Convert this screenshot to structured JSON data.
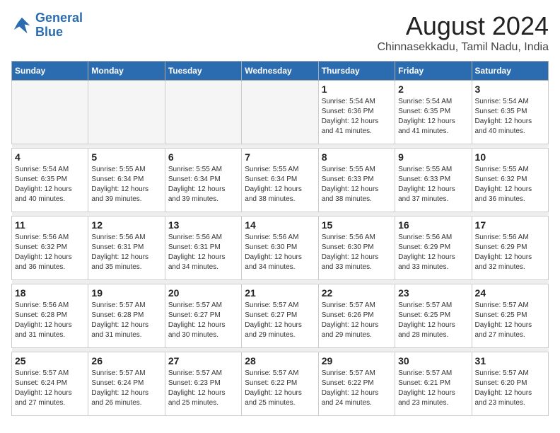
{
  "logo": {
    "line1": "General",
    "line2": "Blue"
  },
  "title": "August 2024",
  "subtitle": "Chinnasekkadu, Tamil Nadu, India",
  "days_of_week": [
    "Sunday",
    "Monday",
    "Tuesday",
    "Wednesday",
    "Thursday",
    "Friday",
    "Saturday"
  ],
  "weeks": [
    [
      {
        "date": "",
        "info": ""
      },
      {
        "date": "",
        "info": ""
      },
      {
        "date": "",
        "info": ""
      },
      {
        "date": "",
        "info": ""
      },
      {
        "date": "1",
        "info": "Sunrise: 5:54 AM\nSunset: 6:36 PM\nDaylight: 12 hours\nand 41 minutes."
      },
      {
        "date": "2",
        "info": "Sunrise: 5:54 AM\nSunset: 6:35 PM\nDaylight: 12 hours\nand 41 minutes."
      },
      {
        "date": "3",
        "info": "Sunrise: 5:54 AM\nSunset: 6:35 PM\nDaylight: 12 hours\nand 40 minutes."
      }
    ],
    [
      {
        "date": "4",
        "info": "Sunrise: 5:54 AM\nSunset: 6:35 PM\nDaylight: 12 hours\nand 40 minutes."
      },
      {
        "date": "5",
        "info": "Sunrise: 5:55 AM\nSunset: 6:34 PM\nDaylight: 12 hours\nand 39 minutes."
      },
      {
        "date": "6",
        "info": "Sunrise: 5:55 AM\nSunset: 6:34 PM\nDaylight: 12 hours\nand 39 minutes."
      },
      {
        "date": "7",
        "info": "Sunrise: 5:55 AM\nSunset: 6:34 PM\nDaylight: 12 hours\nand 38 minutes."
      },
      {
        "date": "8",
        "info": "Sunrise: 5:55 AM\nSunset: 6:33 PM\nDaylight: 12 hours\nand 38 minutes."
      },
      {
        "date": "9",
        "info": "Sunrise: 5:55 AM\nSunset: 6:33 PM\nDaylight: 12 hours\nand 37 minutes."
      },
      {
        "date": "10",
        "info": "Sunrise: 5:55 AM\nSunset: 6:32 PM\nDaylight: 12 hours\nand 36 minutes."
      }
    ],
    [
      {
        "date": "11",
        "info": "Sunrise: 5:56 AM\nSunset: 6:32 PM\nDaylight: 12 hours\nand 36 minutes."
      },
      {
        "date": "12",
        "info": "Sunrise: 5:56 AM\nSunset: 6:31 PM\nDaylight: 12 hours\nand 35 minutes."
      },
      {
        "date": "13",
        "info": "Sunrise: 5:56 AM\nSunset: 6:31 PM\nDaylight: 12 hours\nand 34 minutes."
      },
      {
        "date": "14",
        "info": "Sunrise: 5:56 AM\nSunset: 6:30 PM\nDaylight: 12 hours\nand 34 minutes."
      },
      {
        "date": "15",
        "info": "Sunrise: 5:56 AM\nSunset: 6:30 PM\nDaylight: 12 hours\nand 33 minutes."
      },
      {
        "date": "16",
        "info": "Sunrise: 5:56 AM\nSunset: 6:29 PM\nDaylight: 12 hours\nand 33 minutes."
      },
      {
        "date": "17",
        "info": "Sunrise: 5:56 AM\nSunset: 6:29 PM\nDaylight: 12 hours\nand 32 minutes."
      }
    ],
    [
      {
        "date": "18",
        "info": "Sunrise: 5:56 AM\nSunset: 6:28 PM\nDaylight: 12 hours\nand 31 minutes."
      },
      {
        "date": "19",
        "info": "Sunrise: 5:57 AM\nSunset: 6:28 PM\nDaylight: 12 hours\nand 31 minutes."
      },
      {
        "date": "20",
        "info": "Sunrise: 5:57 AM\nSunset: 6:27 PM\nDaylight: 12 hours\nand 30 minutes."
      },
      {
        "date": "21",
        "info": "Sunrise: 5:57 AM\nSunset: 6:27 PM\nDaylight: 12 hours\nand 29 minutes."
      },
      {
        "date": "22",
        "info": "Sunrise: 5:57 AM\nSunset: 6:26 PM\nDaylight: 12 hours\nand 29 minutes."
      },
      {
        "date": "23",
        "info": "Sunrise: 5:57 AM\nSunset: 6:25 PM\nDaylight: 12 hours\nand 28 minutes."
      },
      {
        "date": "24",
        "info": "Sunrise: 5:57 AM\nSunset: 6:25 PM\nDaylight: 12 hours\nand 27 minutes."
      }
    ],
    [
      {
        "date": "25",
        "info": "Sunrise: 5:57 AM\nSunset: 6:24 PM\nDaylight: 12 hours\nand 27 minutes."
      },
      {
        "date": "26",
        "info": "Sunrise: 5:57 AM\nSunset: 6:24 PM\nDaylight: 12 hours\nand 26 minutes."
      },
      {
        "date": "27",
        "info": "Sunrise: 5:57 AM\nSunset: 6:23 PM\nDaylight: 12 hours\nand 25 minutes."
      },
      {
        "date": "28",
        "info": "Sunrise: 5:57 AM\nSunset: 6:22 PM\nDaylight: 12 hours\nand 25 minutes."
      },
      {
        "date": "29",
        "info": "Sunrise: 5:57 AM\nSunset: 6:22 PM\nDaylight: 12 hours\nand 24 minutes."
      },
      {
        "date": "30",
        "info": "Sunrise: 5:57 AM\nSunset: 6:21 PM\nDaylight: 12 hours\nand 23 minutes."
      },
      {
        "date": "31",
        "info": "Sunrise: 5:57 AM\nSunset: 6:20 PM\nDaylight: 12 hours\nand 23 minutes."
      }
    ]
  ]
}
